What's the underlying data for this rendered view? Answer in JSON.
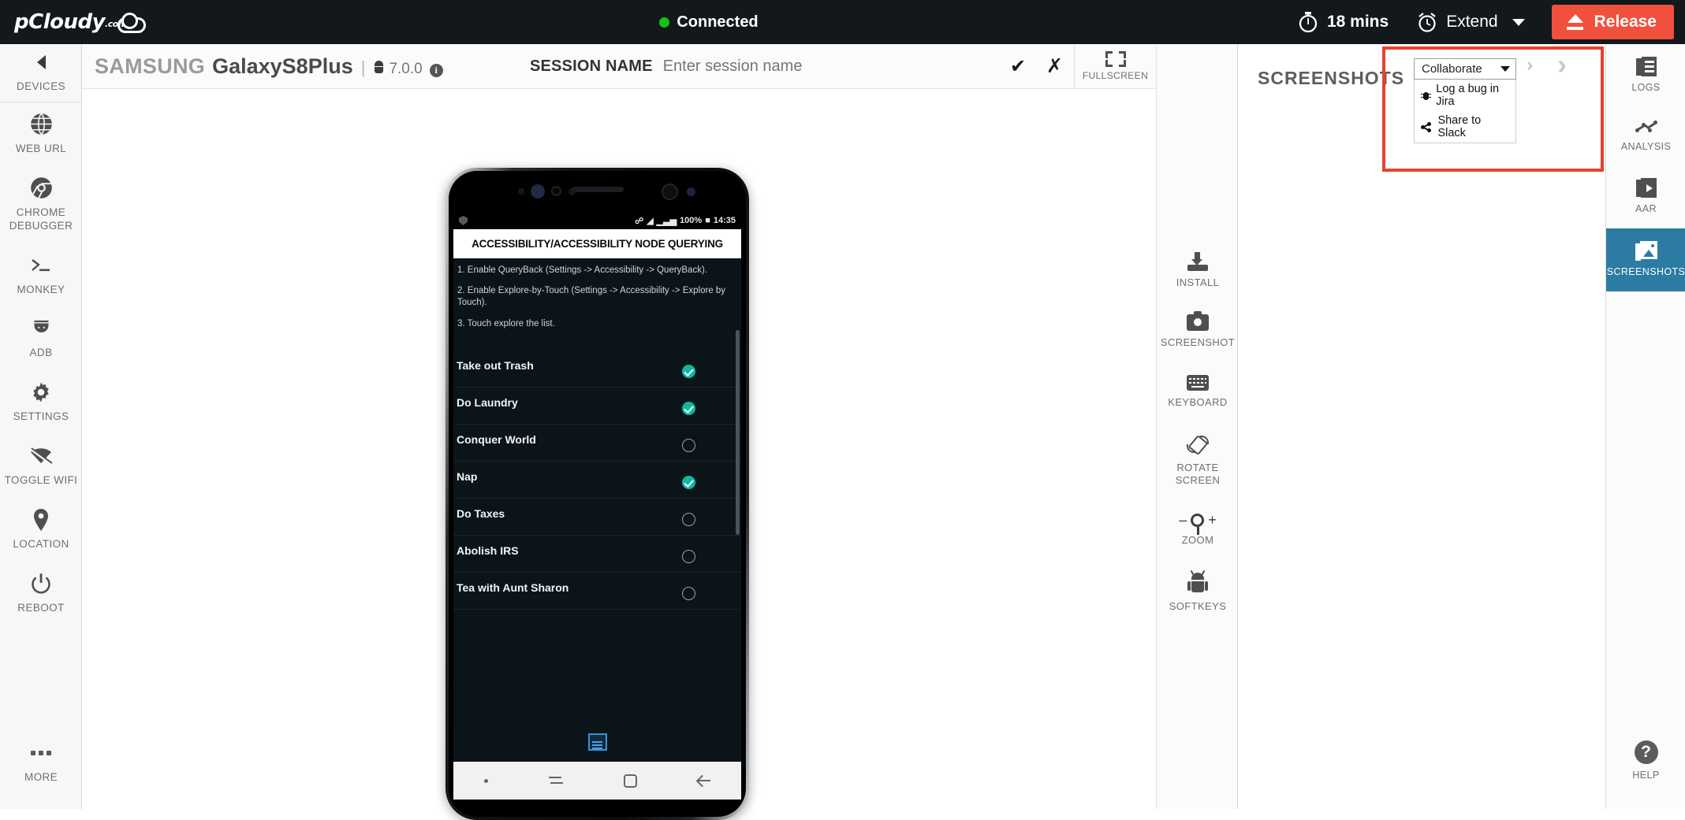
{
  "topbar": {
    "logo": "pCloudy",
    "logo_suffix": ".com",
    "status": "Connected",
    "timer_value": "18 mins",
    "extend_label": "Extend",
    "release_label": "Release"
  },
  "left_sidebar": {
    "items": [
      {
        "label": "DEVICES",
        "icon": "chevron-left-icon"
      },
      {
        "label": "WEB URL",
        "icon": "globe-icon"
      },
      {
        "label": "CHROME DEBUGGER",
        "icon": "chrome-icon"
      },
      {
        "label": "MONKEY",
        "icon": "terminal-icon"
      },
      {
        "label": "ADB",
        "icon": "android-icon"
      },
      {
        "label": "SETTINGS",
        "icon": "gear-icon"
      },
      {
        "label": "TOGGLE WIFI",
        "icon": "wifi-off-icon"
      },
      {
        "label": "LOCATION",
        "icon": "map-pin-icon"
      },
      {
        "label": "REBOOT",
        "icon": "power-icon"
      }
    ],
    "more_label": "MORE"
  },
  "device_header": {
    "brand": "SAMSUNG",
    "model": "GalaxyS8Plus",
    "separator": "|",
    "os_version": "7.0.0",
    "session_label": "SESSION NAME",
    "session_value": "",
    "session_placeholder": "Enter session name",
    "confirm_icon": "check-icon",
    "cancel_icon": "close-icon",
    "fullscreen_label": "FULLSCREEN"
  },
  "phone": {
    "statusbar": {
      "left_icon": "shield-icon",
      "bluetooth": "bluetooth-icon",
      "wifi": "wifi-icon",
      "signal": "signal-icon",
      "battery_percent": "100%",
      "time": "14:35"
    },
    "app_title": "ACCESSIBILITY/ACCESSIBILITY NODE QUERYING",
    "instructions": [
      "1. Enable QueryBack (Settings -> Accessibility -> QueryBack).",
      "2. Enable Explore-by-Touch (Settings -> Accessibility -> Explore by Touch).",
      "3. Touch explore the list."
    ],
    "todo_list": [
      {
        "label": "Take out Trash",
        "checked": true
      },
      {
        "label": "Do Laundry",
        "checked": true
      },
      {
        "label": "Conquer World",
        "checked": false
      },
      {
        "label": "Nap",
        "checked": true
      },
      {
        "label": "Do Taxes",
        "checked": false
      },
      {
        "label": "Abolish IRS",
        "checked": false
      },
      {
        "label": "Tea with Aunt Sharon",
        "checked": false
      }
    ],
    "navbar": [
      "dot-icon",
      "recents-icon",
      "home-icon",
      "back-icon"
    ]
  },
  "tools": {
    "items": [
      {
        "label": "INSTALL",
        "icon": "download-icon"
      },
      {
        "label": "SCREENSHOT",
        "icon": "camera-icon"
      },
      {
        "label": "KEYBOARD",
        "icon": "keyboard-icon"
      },
      {
        "label": "ROTATE SCREEN",
        "icon": "rotate-icon"
      },
      {
        "label": "ZOOM",
        "icon": "magnifier-icon"
      },
      {
        "label": "SOFTKEYS",
        "icon": "android-robot-icon"
      }
    ],
    "zoom_minus": "–",
    "zoom_plus": "+"
  },
  "screenshots_panel": {
    "title": "SCREENSHOTS",
    "collaborate_selected": "Collaborate",
    "collaborate_options": [
      {
        "label": "Log a bug in Jira",
        "icon": "bug-icon"
      },
      {
        "label": "Share to Slack",
        "icon": "share-icon"
      }
    ],
    "next_arrow_small": "›",
    "next_arrow_big": "›",
    "highlight_color": "#e8412d"
  },
  "right_sidebar": {
    "items": [
      {
        "label": "LOGS",
        "icon": "logs-icon",
        "active": false
      },
      {
        "label": "ANALYSIS",
        "icon": "analytics-icon",
        "active": false
      },
      {
        "label": "AAR",
        "icon": "video-icon",
        "active": false
      },
      {
        "label": "SCREENSHOTS",
        "icon": "screenshots-icon",
        "active": true
      }
    ],
    "help_label": "HELP",
    "active_color": "#2b7ba3"
  }
}
